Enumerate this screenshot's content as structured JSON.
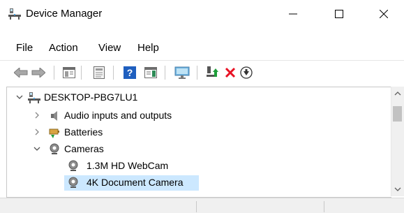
{
  "window": {
    "title": "Device Manager",
    "minimize_glyph": "—",
    "maximize_glyph": "☐",
    "close_glyph": "✕"
  },
  "menu": {
    "items": [
      {
        "label": "File"
      },
      {
        "label": "Action"
      },
      {
        "label": "View"
      },
      {
        "label": "Help"
      }
    ]
  },
  "toolbar": {
    "icons": [
      "back-arrow-icon",
      "forward-arrow-icon",
      "show-hide-console-tree-icon",
      "properties-icon",
      "help-icon",
      "action-pane-icon",
      "scan-hardware-changes-icon",
      "update-driver-icon",
      "uninstall-device-icon",
      "disable-device-icon"
    ]
  },
  "tree": {
    "root": {
      "label": "DESKTOP-PBG7LU1",
      "expanded": true
    },
    "nodes": [
      {
        "label": "Audio inputs and outputs",
        "expanded": false,
        "icon": "speaker-icon"
      },
      {
        "label": "Batteries",
        "expanded": false,
        "icon": "battery-icon"
      },
      {
        "label": "Cameras",
        "expanded": true,
        "icon": "camera-icon",
        "children": [
          {
            "label": "1.3M HD WebCam",
            "icon": "camera-icon",
            "selected": false
          },
          {
            "label": "4K Document Camera",
            "icon": "camera-icon",
            "selected": true
          }
        ]
      }
    ]
  },
  "colors": {
    "selection": "#cce8ff",
    "uninstall_red": "#e81123",
    "update_green": "#1e9e3a",
    "help_blue": "#1f5fbf"
  }
}
